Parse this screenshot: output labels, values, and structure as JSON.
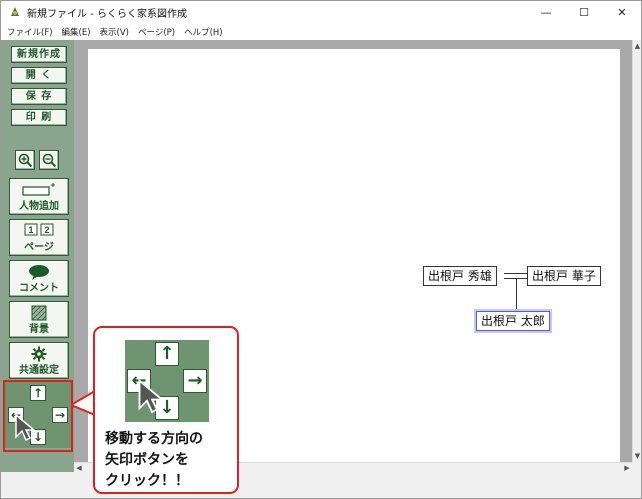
{
  "window": {
    "title": "新規ファイル - らくらく家系図作成",
    "minimize": "—",
    "maximize": "☐",
    "close": "✕"
  },
  "menu": {
    "items": [
      "ファイル(F)",
      "編集(E)",
      "表示(V)",
      "ページ(P)",
      "ヘルプ(H)"
    ]
  },
  "sidebar": {
    "new_label": "新規作成",
    "open_label": "開 く",
    "save_label": "保 存",
    "print_label": "印 刷",
    "zoom_in_icon": "zoom-in-icon",
    "zoom_out_icon": "zoom-out-icon",
    "add_person_label": "人物追加",
    "page_label": "ページ",
    "page_numbers": [
      "1",
      "2"
    ],
    "comment_label": "コメント",
    "background_label": "背景",
    "settings_label": "共通設定",
    "arrows": {
      "up": "↑",
      "down": "↓",
      "left": "←",
      "right": "→"
    }
  },
  "tree": {
    "people": [
      {
        "name": "出根戸 秀雄"
      },
      {
        "name": "出根戸 華子"
      },
      {
        "name": "出根戸 太郎",
        "selected": true
      }
    ]
  },
  "callout": {
    "text_lines": [
      "移動する方向の",
      "矢印ボタンを",
      "クリック！！"
    ],
    "arrows": {
      "up": "↑",
      "down": "↓",
      "left": "←",
      "right": "→"
    }
  },
  "colors": {
    "sidebar_bg": "#8aa58e",
    "button_text": "#1d5a25",
    "highlight_red": "#e02020",
    "selected_border": "#5a5fc8"
  }
}
